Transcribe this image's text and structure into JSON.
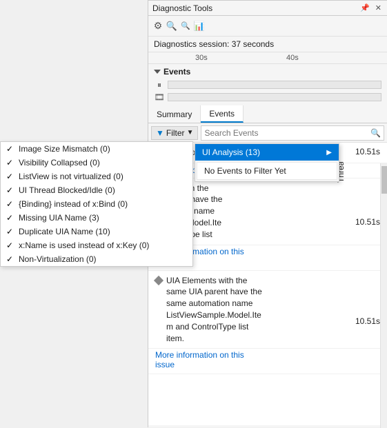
{
  "panel": {
    "title": "Diagnostic Tools",
    "session_label": "Diagnostics session: 37 seconds",
    "timeline": {
      "ruler_30s": "30s",
      "ruler_40s": "40s"
    },
    "events_section_label": "Events"
  },
  "tabs": [
    {
      "label": "Summary",
      "active": false
    },
    {
      "label": "Events",
      "active": true
    }
  ],
  "filter_bar": {
    "filter_label": "Filter",
    "search_placeholder": "Search Events",
    "search_icon": "🔍"
  },
  "dropdown": {
    "item1_label": "UI Analysis (13)",
    "item1_submenu_arrow": "▶",
    "no_events_label": "No Events to Filter Yet",
    "thread_label": "Thread"
  },
  "checklist": {
    "items": [
      {
        "label": "Image Size Mismatch (0)",
        "checked": true
      },
      {
        "label": "Visibility Collapsed (0)",
        "checked": true
      },
      {
        "label": "ListView is not virtualized (0)",
        "checked": true
      },
      {
        "label": "UI Thread Blocked/Idle (0)",
        "checked": true
      },
      {
        "label": "{Binding} instead of x:Bind (0)",
        "checked": true
      },
      {
        "label": "Missing UIA Name (3)",
        "checked": true
      },
      {
        "label": "Duplicate UIA Name (10)",
        "checked": true
      },
      {
        "label": "x:Name is used instead of x:Key (0)",
        "checked": true
      },
      {
        "label": "Non-Virtualization (0)",
        "checked": true
      }
    ]
  },
  "content": {
    "items": [
      {
        "text": "ControlType list",
        "timestamp": "10.51s",
        "more_info_link": null,
        "has_diamond": false
      },
      {
        "text": "formation on this",
        "timestamp": "",
        "more_info_link": null,
        "has_diamond": false,
        "is_partial": true
      },
      {
        "text": "ments with the\nIA parent have the\nutomation name\niSample.Model.Ite\nControlType list",
        "timestamp": "10.51s",
        "more_info_link": null,
        "has_diamond": false
      },
      {
        "text": "More information on this\nissue",
        "timestamp": "",
        "more_info_link": true,
        "has_diamond": false
      },
      {
        "text": "UIA Elements with the\nsame UIA parent have the\nsame automation name\nListViewSample.Model.Ite\nm and ControlType list\nitem.",
        "timestamp": "10.51s",
        "more_info_link": null,
        "has_diamond": true
      },
      {
        "text": "More information on this\nissue",
        "timestamp": "",
        "more_info_link": true,
        "has_diamond": false
      }
    ]
  },
  "icons": {
    "settings": "⚙",
    "zoom_in": "🔍",
    "zoom_out": "🔍",
    "chart": "📊",
    "pause": "⏸",
    "camera": "📷",
    "pin": "📌",
    "close": "✕",
    "filter": "▼"
  }
}
